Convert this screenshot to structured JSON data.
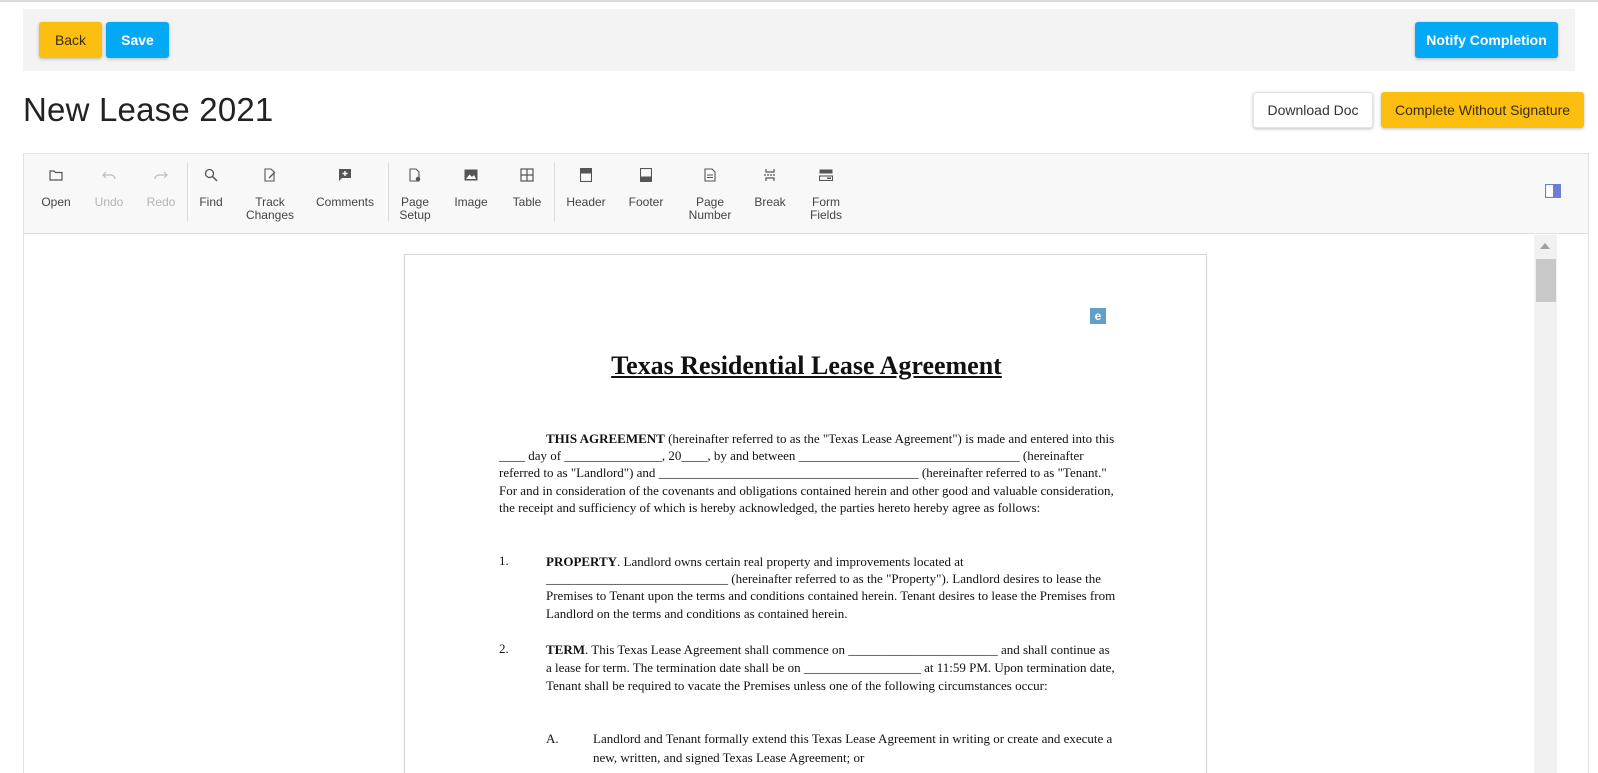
{
  "header": {
    "back_label": "Back",
    "save_label": "Save",
    "notify_label": "Notify Completion"
  },
  "page": {
    "title": "New Lease 2021",
    "download_label": "Download Doc",
    "complete_label": "Complete Without Signature"
  },
  "toolbar": {
    "open": "Open",
    "undo": "Undo",
    "redo": "Redo",
    "find": "Find",
    "track_changes": "Track Changes",
    "comments": "Comments",
    "page_setup": "Page Setup",
    "image": "Image",
    "table": "Table",
    "header": "Header",
    "footer": "Footer",
    "page_number": "Page Number",
    "break": "Break",
    "form_fields": "Form Fields"
  },
  "document": {
    "badge": "e",
    "title": "Texas Residential Lease Agreement",
    "intro_bold": "THIS AGREEMENT",
    "intro_text": " (hereinafter referred to as the \"Texas Lease Agreement\") is made and entered into this ____ day of _______________, 20____, by and between __________________________________ (hereinafter referred to as \"Landlord\") and ________________________________________ (hereinafter referred to as \"Tenant.\" For and in consideration of the covenants and obligations contained herein and other good and valuable consideration, the receipt and sufficiency of which is hereby acknowledged, the parties hereto hereby agree as follows:",
    "items": [
      {
        "num": "1.",
        "bold": "PROPERTY",
        "text": ". Landlord owns certain real property and improvements located at ____________________________ (hereinafter referred to as the \"Property\"). Landlord desires to lease the Premises to Tenant upon the terms and conditions contained herein. Tenant desires to lease the Premises from Landlord on the terms and conditions as contained herein."
      },
      {
        "num": "2.",
        "bold": "TERM",
        "text": ". This Texas Lease Agreement shall commence on _______________________ and shall continue as a lease for term. The termination date shall be on __________________ at 11:59 PM. Upon termination date, Tenant shall be required to vacate the Premises unless one of the following circumstances occur:"
      }
    ],
    "sub_items": [
      {
        "letter": "A.",
        "text": "Landlord and Tenant formally extend this Texas Lease Agreement in writing or create and execute a new, written, and signed Texas Lease Agreement; or"
      }
    ]
  },
  "colors": {
    "yellow": "#fdbf0f",
    "blue": "#03a9f4"
  }
}
